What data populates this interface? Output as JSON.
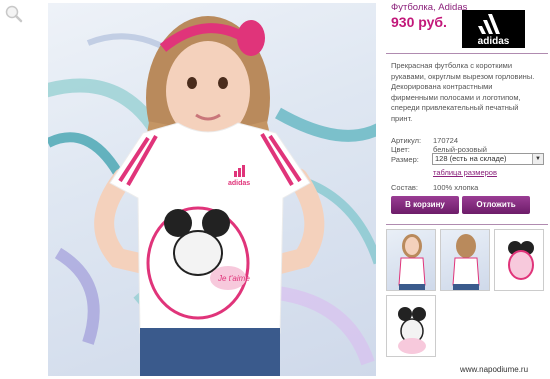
{
  "product": {
    "title": "Футболка, Adidas",
    "price": "930 руб.",
    "brand_logo": "adidas",
    "description": "Прекрасная футболка с короткими рукавами, округлым вырезом горловины. Декорирована контрастными фирменными полосами и логотипом, спереди привлекательный печатный принт."
  },
  "details": {
    "article_label": "Артикул:",
    "article_value": "170724",
    "color_label": "Цвет:",
    "color_value": "белый-розовый",
    "size_label": "Размер:",
    "size_value": "128 (есть на складе)",
    "size_table_link": "таблица размеров",
    "composition_label": "Состав:",
    "composition_value": "100% хлопка"
  },
  "buttons": {
    "cart": "В корзину",
    "defer": "Отложить"
  },
  "photo": {
    "shirt_logo": "adidas",
    "print_text": "Je t'aime"
  },
  "watermark": "www.napodiume.ru",
  "colors": {
    "accent": "#8a1f7a",
    "price": "#c2187a",
    "button": "#7d2378"
  },
  "icons": {
    "zoom": "magnifier-icon"
  }
}
